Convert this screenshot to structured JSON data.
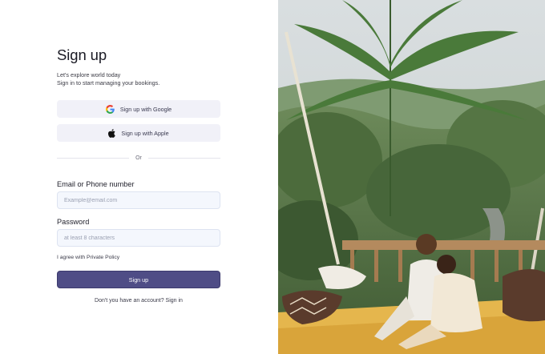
{
  "form": {
    "title": "Sign up",
    "subtitle_line1": "Let's explore world today",
    "subtitle_line2": "Sign in to start managing your bookings.",
    "google_label": "Sign up with Google",
    "apple_label": "Sign up with Apple",
    "divider_text": "Or",
    "email_label": "Email or Phone number",
    "email_placeholder": "Example@email.com",
    "password_label": "Password",
    "password_placeholder": "at least 8 characters",
    "agree_prefix": "I agree with ",
    "agree_link": "Private Policy",
    "submit_label": "Sign up",
    "footer_prefix": "Don't you have an account? ",
    "footer_link": "Sign in"
  },
  "hero": {
    "icon": "photo-couple-jungle-balcony"
  },
  "colors": {
    "primary": "#4f4d86",
    "social_bg": "#f1f1f8",
    "input_bg": "#f4f7fd",
    "google_blue": "#4285F4",
    "google_red": "#EA4335",
    "google_yellow": "#FBBC05",
    "google_green": "#34A853"
  }
}
